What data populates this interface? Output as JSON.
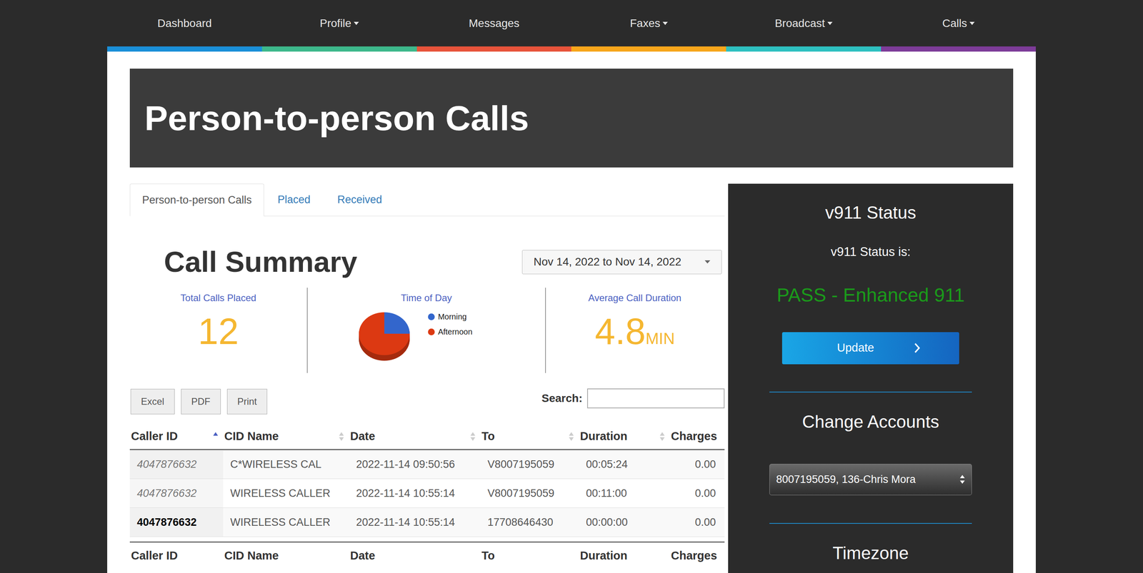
{
  "nav": [
    {
      "label": "Dashboard",
      "dropdown": false,
      "color": "#1a8fd8"
    },
    {
      "label": "Profile",
      "dropdown": true,
      "color": "#3db88b"
    },
    {
      "label": "Messages",
      "dropdown": false,
      "color": "#e8533a"
    },
    {
      "label": "Faxes",
      "dropdown": true,
      "color": "#f7a61b"
    },
    {
      "label": "Broadcast",
      "dropdown": true,
      "color": "#2ec0c0"
    },
    {
      "label": "Calls",
      "dropdown": true,
      "color": "#7d3c98"
    }
  ],
  "banner": {
    "title": "Person-to-person Calls"
  },
  "tabs": [
    {
      "label": "Person-to-person Calls",
      "selected": true
    },
    {
      "label": "Placed",
      "selected": false
    },
    {
      "label": "Received",
      "selected": false
    }
  ],
  "summary": {
    "title": "Call Summary",
    "date_range": "Nov 14, 2022 to Nov 14, 2022",
    "total": {
      "label": "Total Calls Placed",
      "value": "12"
    },
    "time_of_day": {
      "title": "Time of Day",
      "series": [
        {
          "label": "Morning",
          "value": 3,
          "color": "#3366cc"
        },
        {
          "label": "Afternoon",
          "value": 9,
          "color": "#dc3912"
        }
      ]
    },
    "average": {
      "label": "Average Call Duration",
      "value": "4.8",
      "unit": "MIN"
    }
  },
  "export_buttons": [
    "Excel",
    "PDF",
    "Print"
  ],
  "search": {
    "label": "Search:",
    "value": ""
  },
  "table": {
    "columns": [
      {
        "label": "Caller ID",
        "sort": "asc"
      },
      {
        "label": "CID Name",
        "sort": "both"
      },
      {
        "label": "Date",
        "sort": "both"
      },
      {
        "label": "To",
        "sort": "both"
      },
      {
        "label": "Duration",
        "sort": "both"
      },
      {
        "label": "Charges",
        "sort": "none"
      }
    ],
    "rows": [
      {
        "kind": "italic",
        "cells": [
          "4047876632",
          "C*WIRELESS CAL",
          "2022-11-14 09:50:56",
          "V8007195059",
          "00:05:24",
          "0.00"
        ]
      },
      {
        "kind": "italic",
        "cells": [
          "4047876632",
          "WIRELESS CALLER",
          "2022-11-14 10:55:14",
          "V8007195059",
          "00:11:00",
          "0.00"
        ]
      },
      {
        "kind": "bold",
        "cells": [
          "4047876632",
          "WIRELESS CALLER",
          "2022-11-14 10:55:14",
          "17708646430",
          "00:00:00",
          "0.00"
        ]
      }
    ],
    "footer": [
      "Caller ID",
      "CID Name",
      "Date",
      "To",
      "Duration",
      "Charges"
    ]
  },
  "sidebar": {
    "status_title": "v911 Status",
    "status_label": "v911 Status is:",
    "status_value": "PASS - Enhanced 911",
    "update_button": "Update",
    "accounts_title": "Change Accounts",
    "account": "8007195059, 136-Chris Mora",
    "timezone_title": "Timezone"
  }
}
